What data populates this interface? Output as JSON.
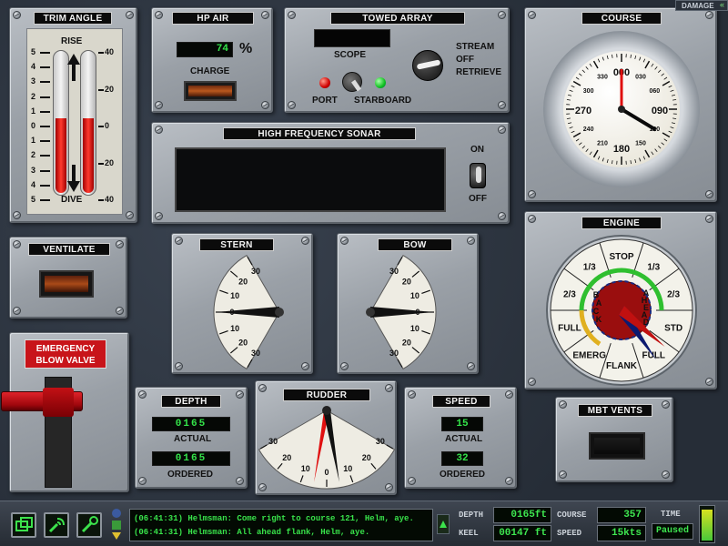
{
  "trim_angle": {
    "title": "TRIM ANGLE",
    "top_label": "RISE",
    "bottom_label": "DIVE",
    "left_scale": [
      "5",
      "4",
      "3",
      "2",
      "1",
      "0",
      "1",
      "2",
      "3",
      "4",
      "5"
    ],
    "right_scale": [
      "40",
      "20",
      "0",
      "20",
      "40"
    ]
  },
  "hp_air": {
    "title": "HP AIR",
    "value": "74",
    "unit": "%",
    "charge_label": "CHARGE"
  },
  "towed_array": {
    "title": "TOWED ARRAY",
    "scope_label": "SCOPE",
    "port_label": "PORT",
    "starboard_label": "STARBOARD",
    "stream_label": "STREAM",
    "off_label": "OFF",
    "retrieve_label": "RETRIEVE"
  },
  "course": {
    "title": "COURSE",
    "marks": [
      "000",
      "030",
      "060",
      "090",
      "120",
      "150",
      "180",
      "210",
      "240",
      "270",
      "300",
      "330"
    ],
    "heading_deg": 121,
    "ordered_deg": 0
  },
  "sonar": {
    "title": "HIGH FREQUENCY SONAR",
    "on_label": "ON",
    "off_label": "OFF"
  },
  "ventilate": {
    "title": "VENTILATE"
  },
  "emergency_blow": {
    "label_line1": "EMERGENCY",
    "label_line2": "BLOW VALVE"
  },
  "stern": {
    "title": "STERN",
    "scale": [
      "30",
      "20",
      "10",
      "0",
      "10",
      "20",
      "30"
    ]
  },
  "bow": {
    "title": "BOW",
    "scale": [
      "30",
      "20",
      "10",
      "0",
      "10",
      "20",
      "30"
    ]
  },
  "engine": {
    "title": "ENGINE",
    "labels": [
      "STOP",
      "1/3",
      "2/3",
      "STD",
      "FULL",
      "FLANK",
      "EMERG",
      "FULL",
      "2/3",
      "1/3"
    ],
    "back_label": "BACK",
    "ahead_label": "AHEAD"
  },
  "depth": {
    "title": "DEPTH",
    "actual": "0165",
    "actual_label": "ACTUAL",
    "ordered": "0165",
    "ordered_label": "ORDERED"
  },
  "rudder": {
    "title": "RUDDER",
    "scale": [
      "30",
      "20",
      "10",
      "0",
      "10",
      "20",
      "30"
    ]
  },
  "speed": {
    "title": "SPEED",
    "actual": "15",
    "actual_label": "ACTUAL",
    "ordered": "32",
    "ordered_label": "ORDERED"
  },
  "mbt_vents": {
    "title": "MBT VENTS"
  },
  "damage": {
    "label": "DAMAGE"
  },
  "messages": [
    "(06:41:31) Helmsman: Come right to course 121, Helm, aye.",
    "(06:41:31) Helmsman: All ahead flank, Helm, aye."
  ],
  "status": {
    "depth_label": "DEPTH",
    "depth_value": "0165ft",
    "keel_label": "KEEL",
    "keel_value": "00147 ft",
    "course_label": "COURSE",
    "course_value": "357",
    "speed_label": "SPEED",
    "speed_value": "15kts",
    "time_label": "TIME",
    "time_value": "Paused"
  },
  "colors": {
    "lcd_green": "#34e34a",
    "emergency_red": "#c8141a",
    "panel_gray": "#a0a6ad"
  }
}
